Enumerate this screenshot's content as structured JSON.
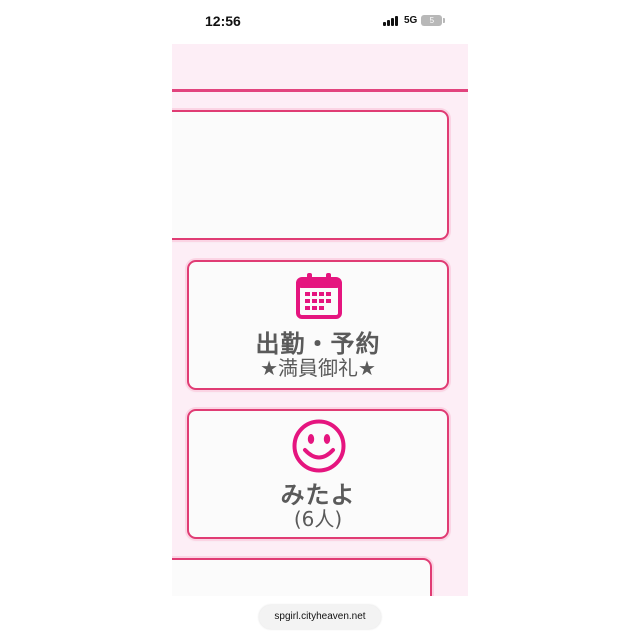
{
  "status_bar": {
    "time": "12:56",
    "network": "5G",
    "battery": "5"
  },
  "schedule_card": {
    "icon": "calendar-icon",
    "title": "出勤・予約",
    "subtitle": "★満員御礼★"
  },
  "mitayo_card": {
    "icon": "smiley-icon",
    "title": "みたよ",
    "subtitle": "(6人)"
  },
  "browser": {
    "url": "spgirl.cityheaven.net"
  },
  "colors": {
    "accent": "#e03c74",
    "icon": "#e5157f",
    "page_bg": "#fdeef6",
    "text": "#5a5a5a"
  }
}
